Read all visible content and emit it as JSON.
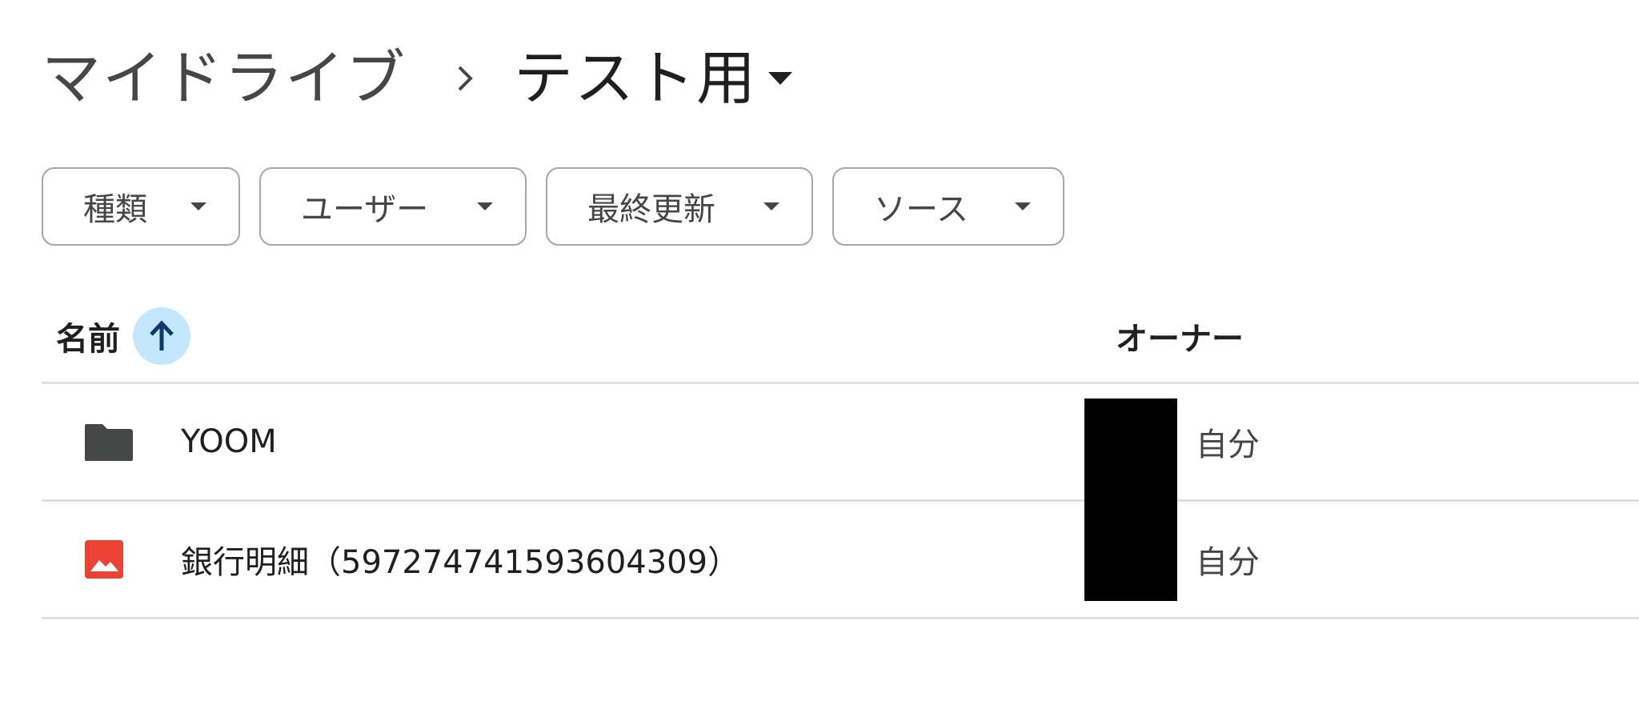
{
  "breadcrumb": {
    "root": "マイドライブ",
    "separator_icon": "chevron-right-icon",
    "current": "テスト用",
    "caret_icon": "caret-down-icon"
  },
  "filters": [
    {
      "label": "種類"
    },
    {
      "label": "ユーザー"
    },
    {
      "label": "最終更新"
    },
    {
      "label": "ソース"
    }
  ],
  "columns": {
    "name": "名前",
    "owner": "オーナー",
    "sort_icon": "arrow-up-icon",
    "sort_direction": "ascending"
  },
  "files": [
    {
      "name": "YOOM",
      "owner": "自分",
      "icon": "folder-icon",
      "icon_color": "#444746"
    },
    {
      "name": "銀行明細（597274741593604309）",
      "owner": "自分",
      "icon": "image-file-icon",
      "icon_color": "#ea4335"
    }
  ],
  "colors": {
    "sort_highlight": "#c2e7ff",
    "sort_arrow": "#0b57d0",
    "text_primary": "#1f1f1f",
    "text_secondary": "#444746"
  }
}
